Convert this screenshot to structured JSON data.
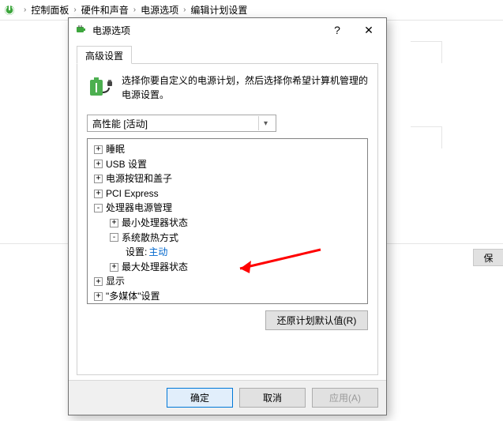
{
  "breadcrumb": {
    "items": [
      "控制面板",
      "硬件和声音",
      "电源选项",
      "编辑计划设置"
    ]
  },
  "parent": {
    "save_button": "保"
  },
  "dialog": {
    "title": "电源选项",
    "tab_label": "高级设置",
    "header_text": "选择你要自定义的电源计划，然后选择你希望计算机管理的电源设置。",
    "plan_selected": "高性能 [活动]",
    "tree": {
      "n0": "睡眠",
      "n1": "USB 设置",
      "n2": "电源按钮和盖子",
      "n3": "PCI Express",
      "n4": "处理器电源管理",
      "n4_0": "最小处理器状态",
      "n4_1": "系统散热方式",
      "n4_1_setting_label": "设置:",
      "n4_1_setting_value": "主动",
      "n4_2": "最大处理器状态",
      "n5": "显示",
      "n6": "\"多媒体\"设置"
    },
    "restore_defaults": "还原计划默认值(R)",
    "ok": "确定",
    "cancel": "取消",
    "apply": "应用(A)"
  }
}
